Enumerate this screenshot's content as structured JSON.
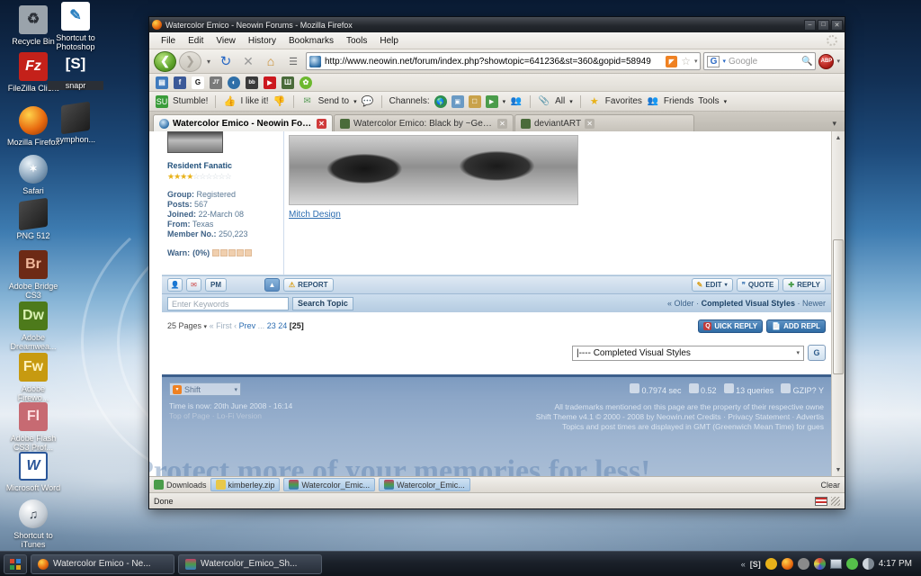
{
  "desktop": {
    "icons": [
      {
        "label": "Recycle Bin",
        "icon": "recycle-bin-icon",
        "glyph": "♻",
        "bg": "#9aa3ab",
        "fg": "#2c3138"
      },
      {
        "label": "Shortcut to Photoshop",
        "icon": "photoshop-icon",
        "glyph": "✎",
        "bg": "#ffffff",
        "fg": "#2a7fbf"
      },
      {
        "label": "FileZilla Client",
        "icon": "filezilla-icon",
        "glyph": "Fz",
        "bg": "#c4211a",
        "fg": "#ffffff"
      },
      {
        "label": "snapr",
        "icon": "snapr-icon",
        "glyph": "[S]",
        "bg": "#2a2f36",
        "fg": "#ffffff"
      },
      {
        "label": "Mozilla Firefox",
        "icon": "firefox-icon",
        "glyph": "●",
        "bg": "#e86b10",
        "fg": "#ffd24a"
      },
      {
        "label": "symphon...",
        "icon": "symphony-icon",
        "glyph": "▬",
        "bg": "#2b2b2b",
        "fg": "#888888"
      },
      {
        "label": "Safari",
        "icon": "safari-icon",
        "glyph": "✶",
        "bg": "#7e9bb5",
        "fg": "#ffffff"
      },
      {
        "label": "PNG 512",
        "icon": "png-file-icon",
        "glyph": "▬",
        "bg": "#2b2b2b",
        "fg": "#888888"
      },
      {
        "label": "Adobe Bridge CS3",
        "icon": "adobe-bridge-icon",
        "glyph": "Br",
        "bg": "#6d2a15",
        "fg": "#f0b79a"
      },
      {
        "label": "Adobe Dreamwea...",
        "icon": "adobe-dreamweaver-icon",
        "glyph": "Dw",
        "bg": "#4d7a1b",
        "fg": "#d8f0b0"
      },
      {
        "label": "Adobe Firewo...",
        "icon": "adobe-fireworks-icon",
        "glyph": "Fw",
        "bg": "#c79a10",
        "fg": "#fff3c0"
      },
      {
        "label": "Adobe Flash CS3 Prof...",
        "icon": "adobe-flash-icon",
        "glyph": "Fl",
        "bg": "#c76a72",
        "fg": "#ffe0e2"
      },
      {
        "label": "Microsoft Word",
        "icon": "microsoft-word-icon",
        "glyph": "W",
        "bg": "#ffffff",
        "fg": "#2a5699"
      },
      {
        "label": "Shortcut to iTunes",
        "icon": "itunes-icon",
        "glyph": "♫",
        "bg": "#d8dde2",
        "fg": "#5a6a7a"
      }
    ]
  },
  "window": {
    "title": "Watercolor Emico - Neowin Forums - Mozilla Firefox",
    "minimize_label": "–",
    "maximize_label": "□",
    "close_label": "✕"
  },
  "menubar": [
    "File",
    "Edit",
    "View",
    "History",
    "Bookmarks",
    "Tools",
    "Help"
  ],
  "navbar": {
    "back_label": "❮",
    "forward_label": "❯",
    "dropdown_label": "▾",
    "reload_label": "↻",
    "stop_label": "✕",
    "home_label": "⌂",
    "readability_label": "☰",
    "url": "http://www.neowin.net/forum/index.php?showtopic=641236&st=360&gopid=58949",
    "rss_label": "◤",
    "star_label": "☆",
    "url_dropdown": "▾",
    "search_engine": "G",
    "search_placeholder": "Google",
    "search_icon": "🔍",
    "adblock_label": "ABP",
    "adblock_dropdown": "▾"
  },
  "bookmarks_toolbar": [
    {
      "name": "bookmark-folder",
      "glyph": "▤",
      "bg": "#3f7bbd"
    },
    {
      "name": "bookmark-facebook",
      "glyph": "f",
      "bg": "#3b5998"
    },
    {
      "name": "bookmark-google",
      "glyph": "G",
      "bg": "#ffffff",
      "fg": "#111111"
    },
    {
      "name": "bookmark-jt",
      "glyph": "JT",
      "bg": "#7a7a7a"
    },
    {
      "name": "bookmark-neowin",
      "glyph": "◐",
      "bg": "#2f6fa8"
    },
    {
      "name": "bookmark-bbc",
      "glyph": "bb",
      "bg": "#3a3a3a"
    },
    {
      "name": "bookmark-youtube",
      "glyph": "▶",
      "bg": "#cc181e"
    },
    {
      "name": "bookmark-deviantart",
      "glyph": "Ш",
      "bg": "#4a6b3a"
    },
    {
      "name": "bookmark-flock",
      "glyph": "✿",
      "bg": "#6cb82e"
    }
  ],
  "addon_toolbar": {
    "stumble_label": "Stumble!",
    "stumble_icon": "stumbleupon-icon",
    "like_label": "I like it!",
    "thumbs_up_icon": "thumbs-up-icon",
    "thumbs_down_icon": "thumbs-down-icon",
    "send_to_label": "Send to",
    "send_to_dropdown": "▾",
    "comment_icon": "comment-bubble-icon",
    "channels_label": "Channels:",
    "channel_icons": [
      "globe-icon",
      "photo-icon",
      "tv-icon",
      "video-icon"
    ],
    "channel_dropdown": "▾",
    "people_icon": "people-icon",
    "clip_icon": "paperclip-icon",
    "all_label": "All",
    "all_dropdown": "▾",
    "favorites_label": "Favorites",
    "favorites_icon": "star-icon",
    "friends_label": "Friends",
    "friends_icon": "friends-icon",
    "tools_label": "Tools",
    "tools_dropdown": "▾"
  },
  "tabs": [
    {
      "label": "Watercolor Emico - Neowin Forums",
      "active": true,
      "close_label": "✕",
      "favicon": "neowin-favicon"
    },
    {
      "label": "Watercolor Emico: Black by ~Gelosea o...",
      "active": false,
      "close_label": "✕",
      "favicon": "deviantart-favicon"
    },
    {
      "label": "deviantART",
      "active": false,
      "close_label": "✕",
      "favicon": "deviantart-favicon"
    }
  ],
  "tab_list_label": "▾",
  "forum": {
    "user": {
      "rank": "Resident Fanatic",
      "stars_filled": 4,
      "stars_total": 10,
      "group_label": "Group:",
      "group_value": "Registered",
      "posts_label": "Posts:",
      "posts_value": "567",
      "joined_label": "Joined:",
      "joined_value": "22-March 08",
      "from_label": "From:",
      "from_value": "Texas",
      "member_no_label": "Member No.:",
      "member_no_value": "250,223",
      "warn_label": "Warn:",
      "warn_value": "(0%)"
    },
    "post": {
      "image_alt": "close-up-eyes-photo",
      "link_text": "Mitch Design"
    },
    "actions": {
      "profile_icon": "profile-icon",
      "email_icon": "email-icon",
      "pm_label": "PM",
      "up_icon": "arrow-up-icon",
      "report_label": "REPORT",
      "edit_label": "EDIT",
      "edit_dropdown": "▾",
      "quote_label": "QUOTE",
      "reply_label": "REPLY"
    },
    "search": {
      "placeholder": "Enter Keywords",
      "button_label": "Search Topic"
    },
    "topic_nav": {
      "older_label": "« Older",
      "separator": "·",
      "current_label": "Completed Visual Styles",
      "newer_label": "Newer"
    },
    "pagination": {
      "pages_label": "25 Pages",
      "pages_dropdown": "▾",
      "first_label": "« First",
      "sep1": "‹",
      "prev_label": "Prev",
      "ellipsis": "...",
      "page_23": "23",
      "page_24": "24",
      "current_page": "[25]"
    },
    "reply_buttons": {
      "quick_reply_label": "UICK REPLY",
      "quick_reply_badge": "Q",
      "add_reply_label": "ADD REPL"
    },
    "forum_select": {
      "value": "|---- Completed Visual Styles",
      "arrow": "▾",
      "go_label": "G"
    },
    "footer": {
      "skin_select_value": "Shift",
      "skin_select_arrow": "▾",
      "rss_icon": "rss-icon",
      "stat_time": "0.7974 sec",
      "stat_load": "0.52",
      "stat_queries": "13 queries",
      "stat_gzip": "GZIP? Y",
      "time_now": "Time is now: 20th June 2008 - 16:14",
      "top_of_page": "Top of Page",
      "lofi": "Lo-Fi Version",
      "trademarks": "All trademarks mentioned on this page are the property of their respective owne",
      "theme_line": "Shift Theme v4.1 © 2000 - 2008 by Neowin.net Credits · Privacy Statement · Advertis",
      "gmt_line": "Topics and post times are displayed in GMT (Greenwich Mean Time) for gues"
    },
    "watermark": "Protect more of your memories for less!"
  },
  "downloads_bar": {
    "downloads_label": "Downloads",
    "downloads_icon": "download-icon",
    "items": [
      {
        "label": "kimberley.zip",
        "icon": "zip-file-icon"
      },
      {
        "label": "Watercolor_Emic...",
        "icon": "archive-file-icon"
      },
      {
        "label": "Watercolor_Emic...",
        "icon": "archive-file-icon"
      }
    ],
    "clear_label": "Clear"
  },
  "statusbar": {
    "text": "Done",
    "flag_icon": "us-flag-icon",
    "grip_icon": "resize-grip-icon"
  },
  "taskbar": {
    "start_label": "start-button",
    "items": [
      {
        "label": "Watercolor Emico - Ne...",
        "icon": "firefox-icon"
      },
      {
        "label": "Watercolor_Emico_Sh...",
        "icon": "archive-file-icon"
      }
    ],
    "tray_expand": "«",
    "tray_icons": [
      {
        "name": "snapr-tray-icon",
        "glyph": "[S]",
        "color": "#d8d8d8"
      },
      {
        "name": "notification-tray-icon",
        "glyph": "●",
        "color": "#e8b21a"
      },
      {
        "name": "firefox-tray-icon",
        "glyph": "●",
        "color": "#e86b10"
      },
      {
        "name": "update-tray-icon",
        "glyph": "●",
        "color": "#8a8a8a"
      },
      {
        "name": "network-tray-icon",
        "glyph": "●",
        "color": "#3a7fd4"
      },
      {
        "name": "display-tray-icon",
        "glyph": "■",
        "color": "#c0c8d0"
      },
      {
        "name": "volume-tray-icon",
        "glyph": "♪",
        "color": "#55c04a"
      },
      {
        "name": "sound-tray-icon",
        "glyph": "◑",
        "color": "#b0b8c0"
      }
    ],
    "clock": "4:17 PM"
  }
}
